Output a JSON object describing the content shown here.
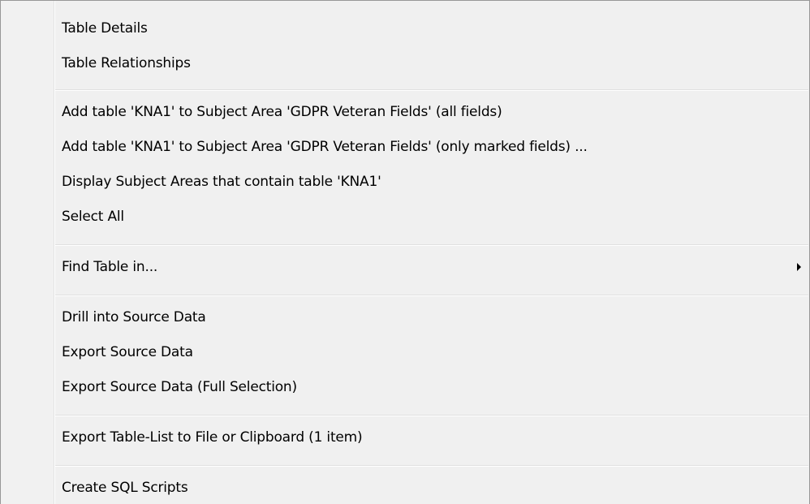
{
  "context_menu": {
    "groups": [
      [
        "Table Details",
        "Table Relationships"
      ],
      [
        "Add table 'KNA1' to Subject Area 'GDPR Veteran Fields' (all fields)",
        "Add table 'KNA1' to Subject Area 'GDPR Veteran Fields' (only marked fields) ...",
        "Display Subject Areas that contain table 'KNA1'",
        "Select All"
      ],
      [
        "Find Table in..."
      ],
      [
        "Drill into Source Data",
        "Export Source Data",
        "Export Source Data (Full Selection)"
      ],
      [
        "Export Table-List to File or Clipboard (1 item)"
      ],
      [
        "Create SQL Scripts"
      ]
    ],
    "submenu_arrow_icon": "triangle-right-icon"
  }
}
